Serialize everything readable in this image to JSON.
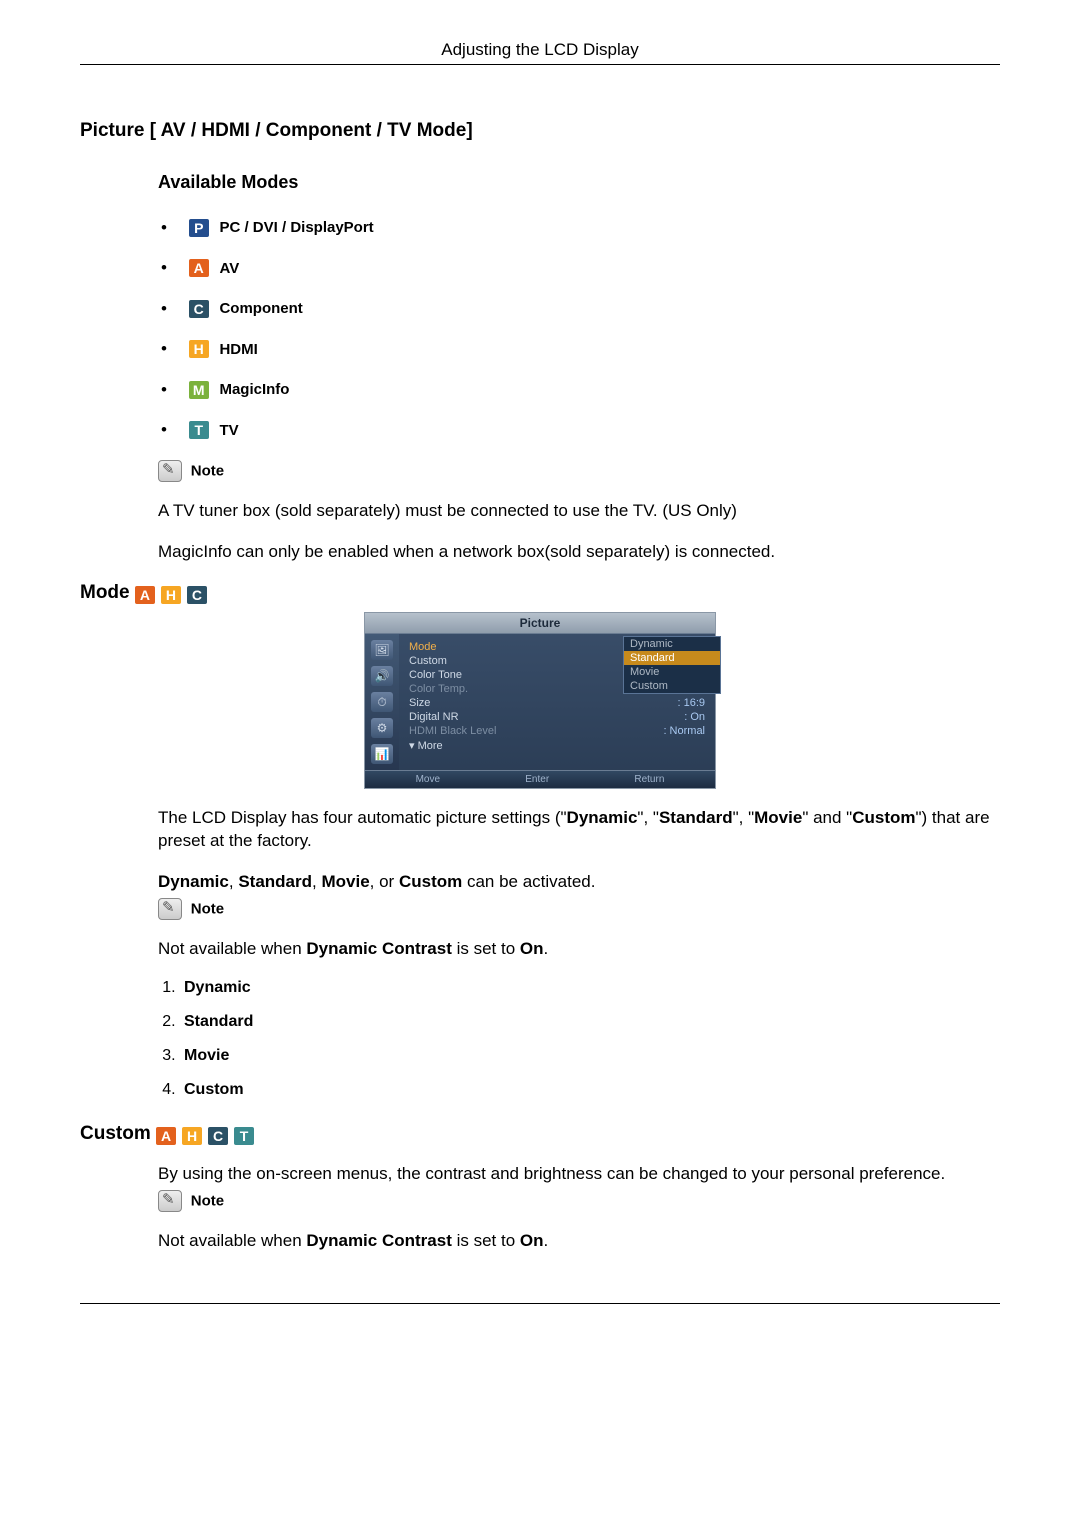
{
  "running_head": "Adjusting the LCD Display",
  "h1": "Picture [ AV / HDMI / Component / TV Mode]",
  "available_modes_heading": "Available Modes",
  "modes": {
    "p": {
      "letter": "P",
      "label": "PC / DVI / DisplayPort"
    },
    "a": {
      "letter": "A",
      "label": "AV"
    },
    "c": {
      "letter": "C",
      "label": "Component"
    },
    "h": {
      "letter": "H",
      "label": "HDMI"
    },
    "m": {
      "letter": "M",
      "label": "MagicInfo"
    },
    "t": {
      "letter": "T",
      "label": "TV"
    }
  },
  "note_label": "Note",
  "note1_line1": "A TV tuner box (sold separately) must be connected to use the TV. (US Only)",
  "note1_line2": "MagicInfo can only be enabled when a network box(sold separately) is connected.",
  "mode_section_title": "Mode",
  "osd": {
    "title": "Picture",
    "rows": [
      {
        "l": "Mode",
        "r": "",
        "muted": false,
        "highlight": true
      },
      {
        "l": "Custom",
        "r": "",
        "muted": false
      },
      {
        "l": "Color Tone",
        "r": ":",
        "muted": false
      },
      {
        "l": "Color Temp.",
        "r": "",
        "muted": true
      },
      {
        "l": "Size",
        "r": ": 16:9",
        "muted": false
      },
      {
        "l": "Digital NR",
        "r": ": On",
        "muted": false
      },
      {
        "l": "HDMI Black Level",
        "r": ": Normal",
        "muted": true
      },
      {
        "l": "▾ More",
        "r": "",
        "muted": false
      }
    ],
    "popup": [
      "Dynamic",
      "Standard",
      "Movie",
      "Custom"
    ],
    "popup_selected": "Standard",
    "foot": [
      "Move",
      "Enter",
      "Return"
    ]
  },
  "mode_body_parts": {
    "pre1": "The LCD Display has four automatic picture settings (\"",
    "b1": "Dynamic",
    "mid1": "\", \"",
    "b2": "Standard",
    "mid2": "\", \"",
    "b3": "Movie",
    "mid3": "\" and \"",
    "b4": "Custom",
    "post": "\") that are preset at the factory."
  },
  "mode_line2_parts": {
    "b1": "Dynamic",
    "c1": ", ",
    "b2": "Standard",
    "c2": ", ",
    "b3": "Movie",
    "c3": ", or ",
    "b4": "Custom",
    "tail": " can be activated."
  },
  "note2_parts": {
    "pre": "Not available when ",
    "b1": "Dynamic Contrast",
    "mid": " is set to ",
    "b2": "On",
    "post": "."
  },
  "numbered": [
    "Dynamic",
    "Standard",
    "Movie",
    "Custom"
  ],
  "custom_section_title": "Custom",
  "custom_body": "By using the on-screen menus, the contrast and brightness can be changed to your personal preference."
}
